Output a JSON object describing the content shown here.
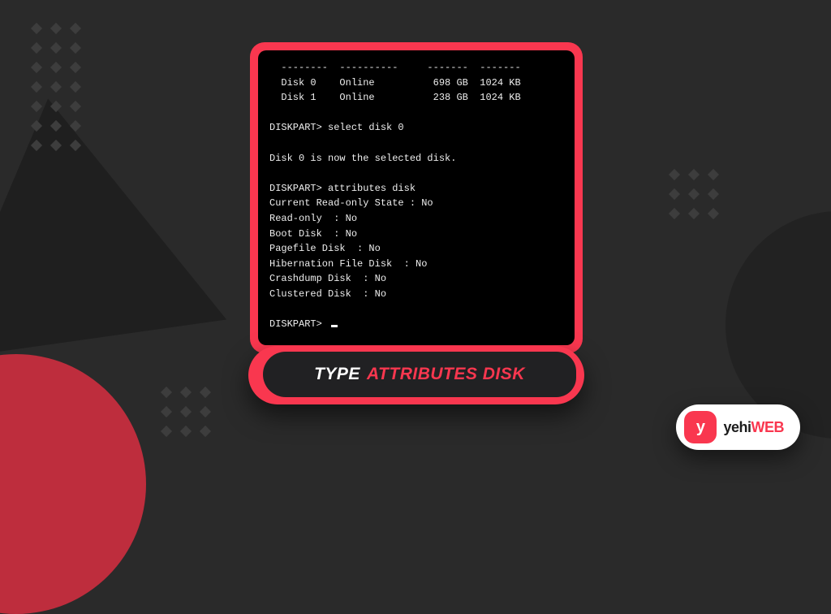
{
  "background": {
    "base_color": "#2a2a2a",
    "accent_color": "#f9374f"
  },
  "terminal": {
    "table_rule": "  --------  ----------     -------  -------",
    "disk0_row": "  Disk 0    Online          698 GB  1024 KB",
    "disk1_row": "  Disk 1    Online          238 GB  1024 KB",
    "cmd_select": "DISKPART> select disk 0",
    "selected_msg": "Disk 0 is now the selected disk.",
    "cmd_attrs": "DISKPART> attributes disk",
    "attr_ro_state": "Current Read-only State : No",
    "attr_ro": "Read-only  : No",
    "attr_boot": "Boot Disk  : No",
    "attr_pagefile": "Pagefile Disk  : No",
    "attr_hiber": "Hibernation File Disk  : No",
    "attr_crash": "Crashdump Disk  : No",
    "attr_cluster": "Clustered Disk  : No",
    "prompt_final": "DISKPART>"
  },
  "caption": {
    "lead": "TYPE",
    "highlight": "ATTRIBUTES DISK"
  },
  "brand": {
    "badge_letter": "y",
    "name_plain": "yehi",
    "name_accent": "WEB"
  }
}
